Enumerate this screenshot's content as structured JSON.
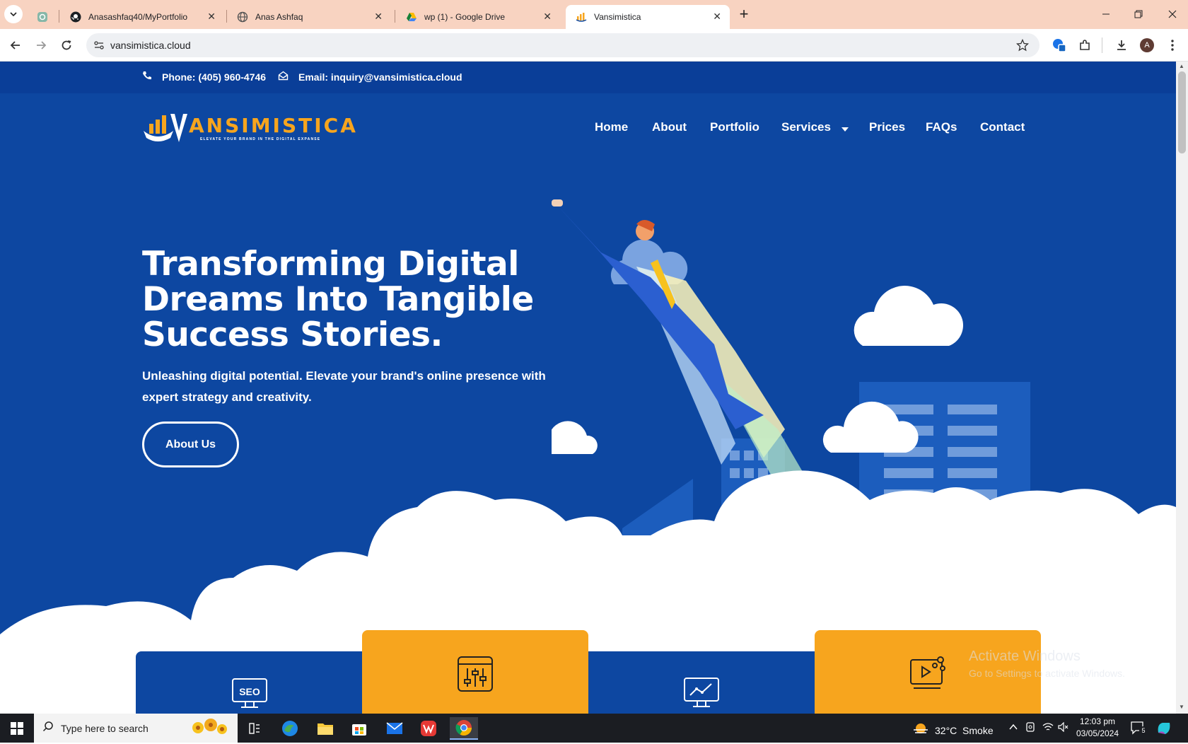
{
  "browser": {
    "tabs": [
      {
        "label": "",
        "icon": "chatgpt-icon"
      },
      {
        "label": "Anasashfaq40/MyPortfolio",
        "icon": "github-icon"
      },
      {
        "label": "Anas Ashfaq",
        "icon": "globe-icon"
      },
      {
        "label": "wp (1) - Google Drive",
        "icon": "google-drive-icon"
      },
      {
        "label": "Vansimistica",
        "icon": "vansimistica-icon"
      }
    ],
    "new_tab": "+",
    "url": "vansimistica.cloud",
    "profile_initial": "A"
  },
  "site": {
    "phone": "Phone: (405) 960-4746",
    "email": "Email: inquiry@vansimistica.cloud",
    "logo": {
      "text": "VANSIMISTICA",
      "tagline": "ELEVATE YOUR BRAND IN THE DIGITAL EXPANSE"
    },
    "nav": [
      "Home",
      "About",
      "Portfolio",
      "Services",
      "Prices",
      "FAQs",
      "Contact"
    ],
    "hero": {
      "title": "Transforming Digital Dreams Into Tangible Success Stories.",
      "subtitle": "Unleashing digital potential. Elevate your brand's online presence with expert strategy and creativity.",
      "button": "About Us"
    },
    "cards": [
      {
        "icon": "seo-monitor-icon",
        "color": "#0d47a1"
      },
      {
        "icon": "sliders-window-icon",
        "color": "#f7a51e"
      },
      {
        "icon": "analytics-monitor-icon",
        "color": "#0d47a1"
      },
      {
        "icon": "video-share-icon",
        "color": "#f7a51e"
      }
    ],
    "seo_label": "SEO"
  },
  "watermark": {
    "title": "Activate Windows",
    "subtitle": "Go to Settings to activate Windows."
  },
  "taskbar": {
    "search_placeholder": "Type here to search",
    "weather": "32°C  Smoke",
    "time": "12:03 pm",
    "date": "03/05/2024",
    "notifications": "5"
  },
  "colors": {
    "brand_blue": "#0d47a1",
    "accent_orange": "#f7a51e",
    "tab_strip": "#f8d3c1"
  }
}
